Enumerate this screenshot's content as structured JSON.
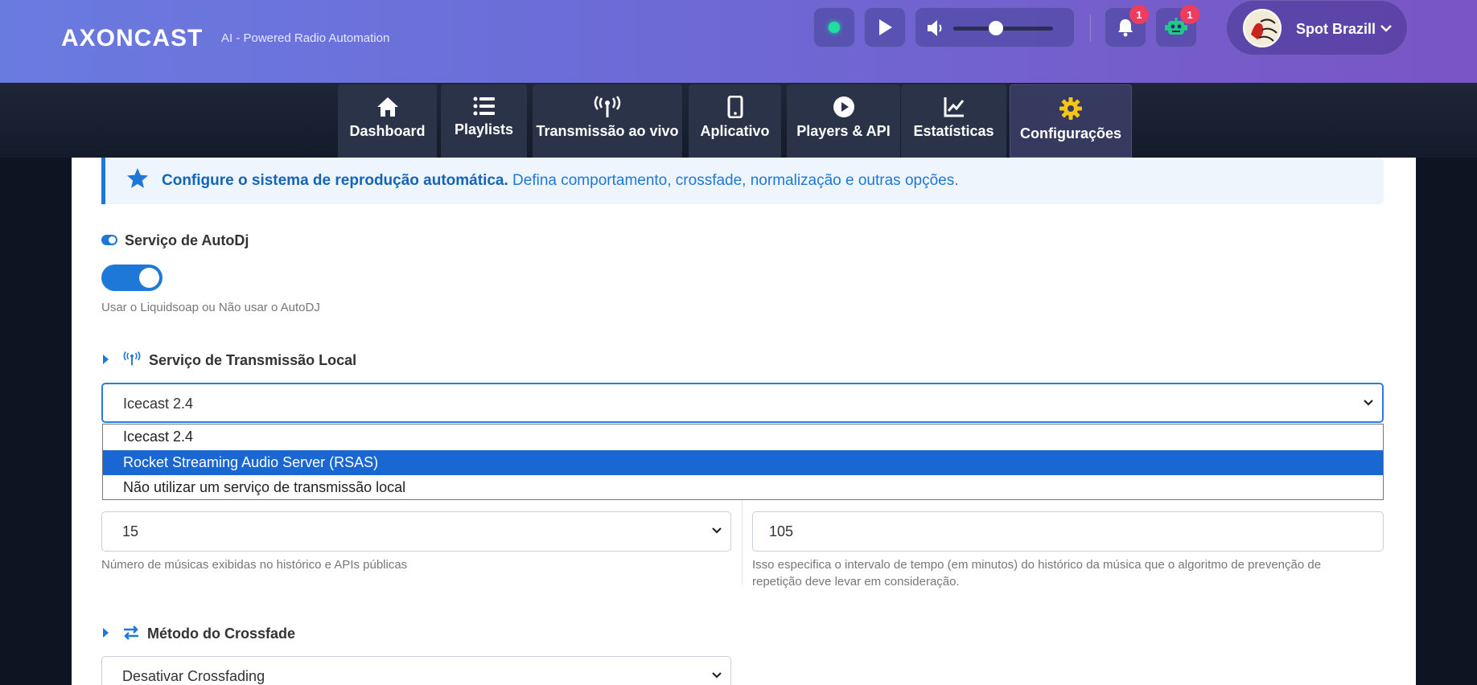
{
  "header": {
    "brand": "AXONCAST",
    "tagline": "AI - Powered Radio Automation",
    "notifications_count": "1",
    "bot_count": "1",
    "volume_level": 0.48,
    "user_name": "Spot Brazill",
    "status_color": "#1fe0a0"
  },
  "nav": {
    "tabs": [
      {
        "label": "Dashboard",
        "icon": "home-icon"
      },
      {
        "label": "Playlists",
        "icon": "list-icon"
      },
      {
        "label": "Transmissão ao vivo",
        "icon": "broadcast-icon"
      },
      {
        "label": "Aplicativo",
        "icon": "phone-icon"
      },
      {
        "label": "Players & API",
        "icon": "play-circle-icon"
      },
      {
        "label": "Estatísticas",
        "icon": "chart-icon"
      },
      {
        "label": "Configurações",
        "icon": "gear-icon"
      }
    ],
    "active_tab": "Configurações"
  },
  "info": {
    "bold": "Configure o sistema de reprodução automática.",
    "text": " Defina comportamento, crossfade, normalização e outras opções."
  },
  "autodj": {
    "label": "Serviço de AutoDj",
    "enabled": true,
    "help": "Usar o Liquidsoap ou Não usar o AutoDJ"
  },
  "local_broadcast": {
    "label": "Serviço de Transmissão Local",
    "selected": "Icecast 2.4",
    "options": [
      "Icecast 2.4",
      "Rocket Streaming Audio Server (RSAS)",
      "Não utilizar um serviço de transmissão local"
    ],
    "highlighted_option": "Rocket Streaming Audio Server (RSAS)"
  },
  "history": {
    "count_value": "15",
    "count_help": "Número de músicas exibidas no histórico e APIs públicas",
    "interval_value": "105",
    "interval_help": "Isso especifica o intervalo de tempo (em minutos) do histórico da música que o algoritmo de prevenção de repetição deve levar em consideração."
  },
  "crossfade": {
    "label": "Método do Crossfade",
    "selected": "Desativar Crossfading"
  },
  "colors": {
    "accent": "#1e78d8",
    "badge": "#ee3c5e",
    "gear_active": "#f5c518"
  }
}
